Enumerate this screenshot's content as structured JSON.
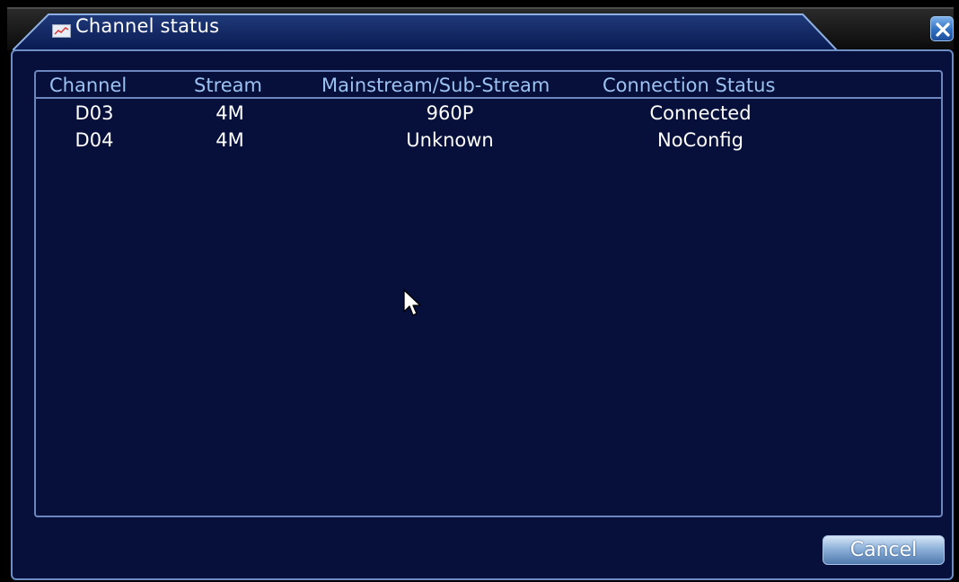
{
  "window": {
    "title": "Channel status"
  },
  "table": {
    "headers": {
      "channel": "Channel",
      "stream": "Stream",
      "mainsub": "Mainstream/Sub-Stream",
      "status": "Connection Status"
    },
    "rows": [
      {
        "channel": "D03",
        "stream": "4M",
        "mainsub": "960P",
        "status": "Connected"
      },
      {
        "channel": "D04",
        "stream": "4M",
        "mainsub": "Unknown",
        "status": "NoConfig"
      }
    ]
  },
  "buttons": {
    "cancel": "Cancel"
  },
  "icons": {
    "title_icon": "chart-icon",
    "close": "close-icon",
    "cursor": "mouse-cursor-icon"
  },
  "colors": {
    "panel_bg": "#06103a",
    "header_text": "#9cc2f2",
    "cell_text": "#ffffff",
    "border": "#6d86bd"
  }
}
